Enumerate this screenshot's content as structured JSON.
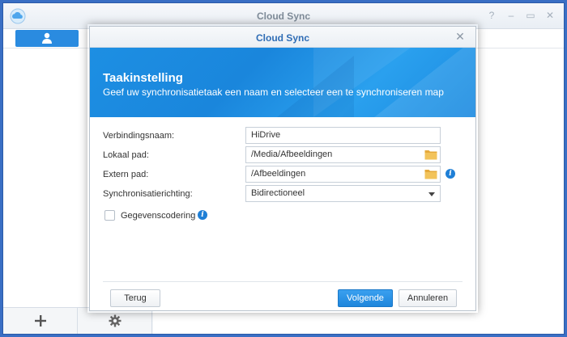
{
  "app": {
    "title": "Cloud Sync"
  },
  "window_controls": [
    "?",
    "–",
    "▭",
    "✕"
  ],
  "dialog": {
    "title": "Cloud Sync",
    "banner_title": "Taakinstelling",
    "banner_subtitle": "Geef uw synchronisatietaak een naam en selecteer een te synchroniseren map",
    "fields": {
      "connection_name": {
        "label": "Verbindingsnaam:",
        "value": "HiDrive"
      },
      "local_path": {
        "label": "Lokaal pad:",
        "value": "/Media/Afbeeldingen"
      },
      "remote_path": {
        "label": "Extern pad:",
        "value": "/Afbeeldingen"
      },
      "sync_direction": {
        "label": "Synchronisatierichting:",
        "value": "Bidirectioneel"
      },
      "encryption": {
        "label": "Gegevenscodering",
        "checked": false
      }
    },
    "buttons": {
      "back": "Terug",
      "next": "Volgende",
      "cancel": "Annuleren"
    }
  },
  "colors": {
    "accent": "#1e86dc",
    "banner": "#1a86dc",
    "frame": "#3a6fc4"
  },
  "icons": {
    "app_logo": "cloud-sync-logo-icon",
    "user_tab": "user-icon",
    "add": "plus-icon",
    "settings": "gear-icon",
    "folder": "folder-icon",
    "info": "info-icon"
  }
}
